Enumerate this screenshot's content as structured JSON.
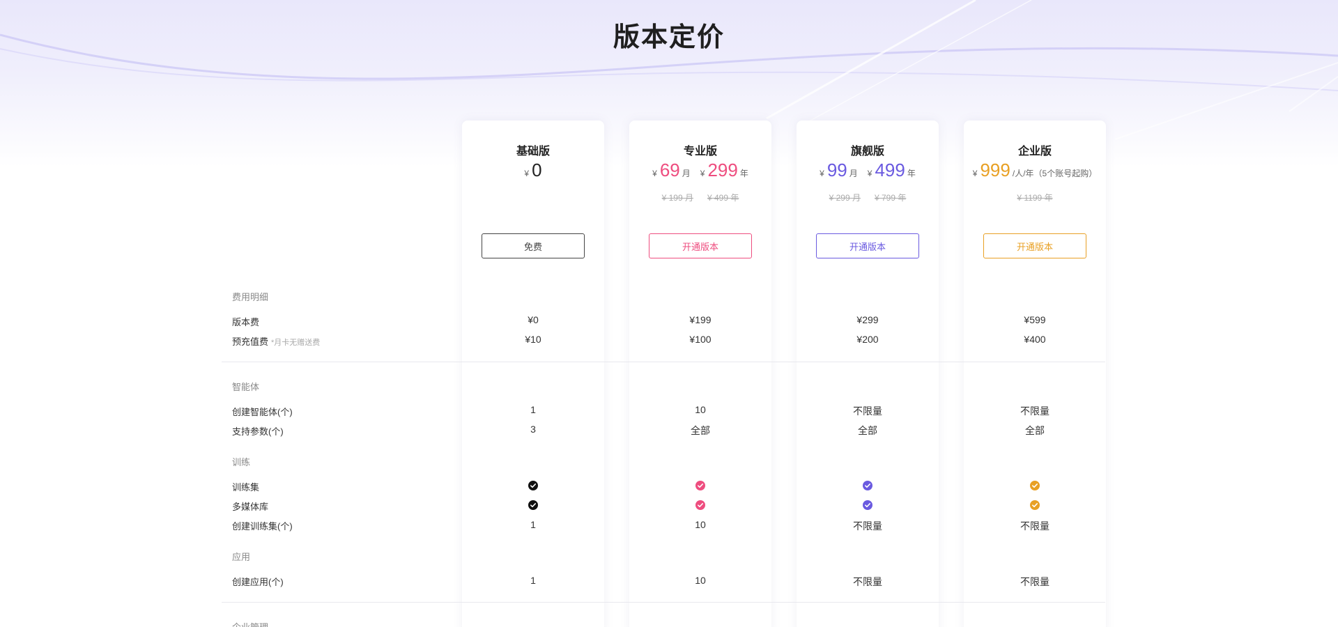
{
  "page": {
    "title": "版本定价"
  },
  "colors": {
    "basic": "#222222",
    "pro": "#ee4d7f",
    "flagship": "#6a5ae0",
    "enterprise": "#e8a024"
  },
  "plans": [
    {
      "name": "基础版",
      "currency": "¥",
      "price_main": "0",
      "button": "免费"
    },
    {
      "name": "专业版",
      "currency": "¥",
      "price_month": "69",
      "unit_month": "月",
      "price_year": "299",
      "unit_year": "年",
      "orig_month": "¥ 199 月",
      "orig_year": "¥ 499 年",
      "button": "开通版本"
    },
    {
      "name": "旗舰版",
      "currency": "¥",
      "price_month": "99",
      "unit_month": "月",
      "price_year": "499",
      "unit_year": "年",
      "orig_month": "¥ 299 月",
      "orig_year": "¥ 799 年",
      "button": "开通版本"
    },
    {
      "name": "企业版",
      "currency": "¥",
      "price_main": "999",
      "unit_main": "/人/年（5个账号起购）",
      "orig_main": "¥ 1199 年",
      "button": "开通版本"
    }
  ],
  "sections": {
    "fees": "费用明细",
    "agents": "智能体",
    "training": "训练",
    "apps": "应用",
    "enterprise": "企业管理"
  },
  "rows": {
    "version_fee": {
      "label": "版本费",
      "values": [
        "¥0",
        "¥199",
        "¥299",
        "¥599"
      ]
    },
    "prepaid": {
      "label": "预充值费",
      "note": "*月卡无赠送费",
      "values": [
        "¥10",
        "¥100",
        "¥200",
        "¥400"
      ]
    },
    "create_agent": {
      "label": "创建智能体(个)",
      "values": [
        "1",
        "10",
        "不限量",
        "不限量"
      ]
    },
    "params": {
      "label": "支持参数(个)",
      "values": [
        "3",
        "全部",
        "全部",
        "全部"
      ]
    },
    "training_set": {
      "label": "训练集"
    },
    "media_lib": {
      "label": "多媒体库"
    },
    "create_training": {
      "label": "创建训练集(个)",
      "values": [
        "1",
        "10",
        "不限量",
        "不限量"
      ]
    },
    "create_app": {
      "label": "创建应用(个)",
      "values": [
        "1",
        "10",
        "不限量",
        "不限量"
      ]
    }
  },
  "icons": {
    "check": "check-circle-icon"
  }
}
